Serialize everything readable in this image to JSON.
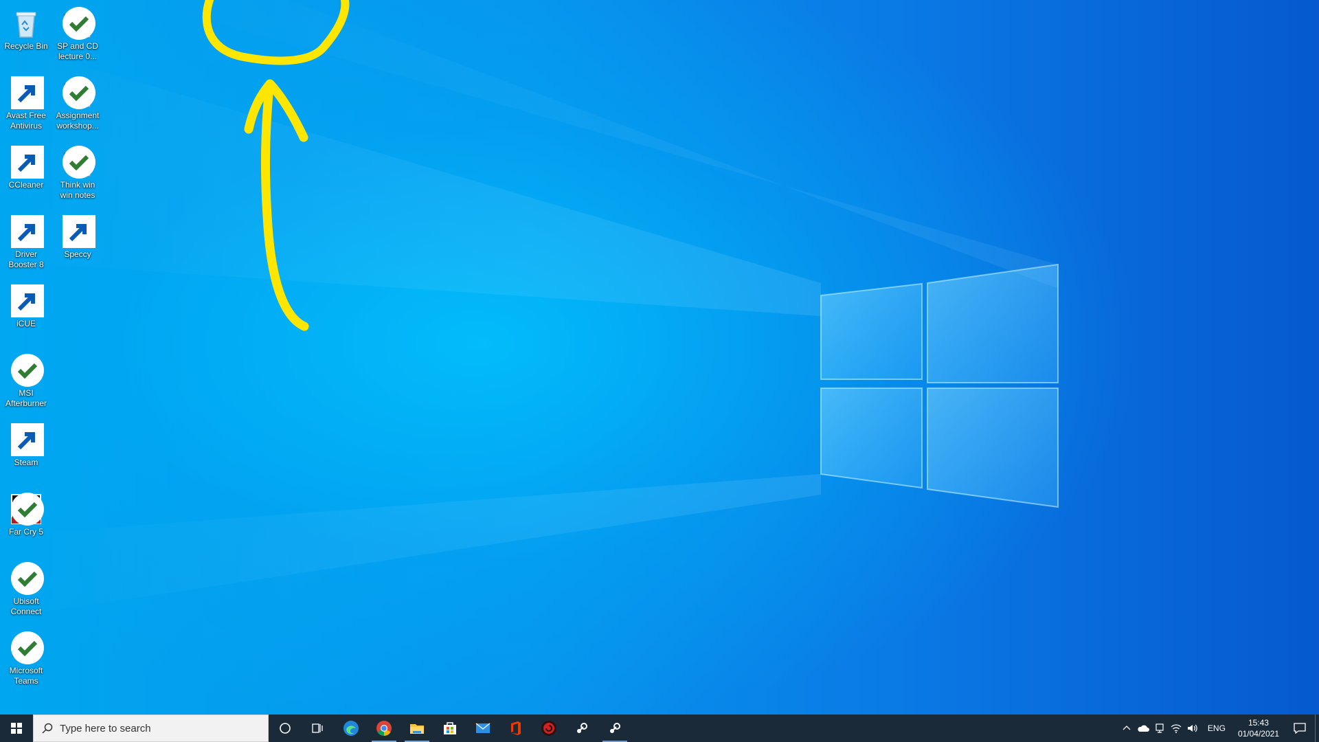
{
  "desktop": {
    "icons": [
      {
        "label": "Recycle Bin",
        "icon": "recycle-bin-icon"
      },
      {
        "label": "SP and CD lecture 0...",
        "icon": "word-document-icon"
      },
      {
        "label": "Avast Free Antivirus",
        "icon": "avast-icon"
      },
      {
        "label": "Assignment workshop...",
        "icon": "word-document-icon"
      },
      {
        "label": "CCleaner",
        "icon": "ccleaner-icon"
      },
      {
        "label": "Think win win notes",
        "icon": "word-document-icon"
      },
      {
        "label": "Driver Booster 8",
        "icon": "driver-booster-icon"
      },
      {
        "label": "Speccy",
        "icon": "speccy-icon"
      },
      {
        "label": "iCUE",
        "icon": "icue-icon"
      },
      {
        "label": "MSI Afterburner",
        "icon": "msi-afterburner-icon"
      },
      {
        "label": "Steam",
        "icon": "steam-icon"
      },
      {
        "label": "Far Cry 5",
        "icon": "far-cry-5-icon"
      },
      {
        "label": "Ubisoft Connect",
        "icon": "ubisoft-connect-icon"
      },
      {
        "label": "Microsoft Teams",
        "icon": "teams-icon"
      }
    ]
  },
  "taskbar": {
    "search_placeholder": "Type here to search",
    "pinned": [
      {
        "name": "cortana-icon"
      },
      {
        "name": "task-view-icon"
      },
      {
        "name": "edge-icon"
      },
      {
        "name": "chrome-icon"
      },
      {
        "name": "file-explorer-icon"
      },
      {
        "name": "microsoft-store-icon"
      },
      {
        "name": "mail-icon"
      },
      {
        "name": "office-icon"
      },
      {
        "name": "driver-booster-icon"
      },
      {
        "name": "steam-icon"
      },
      {
        "name": "steam-icon"
      }
    ],
    "tray": {
      "language": "ENG",
      "time": "15:43",
      "date": "01/04/2021"
    }
  },
  "colors": {
    "taskbar_bg": "#1b2a38",
    "annotation": "#ffe600",
    "accent": "#0078d7"
  }
}
